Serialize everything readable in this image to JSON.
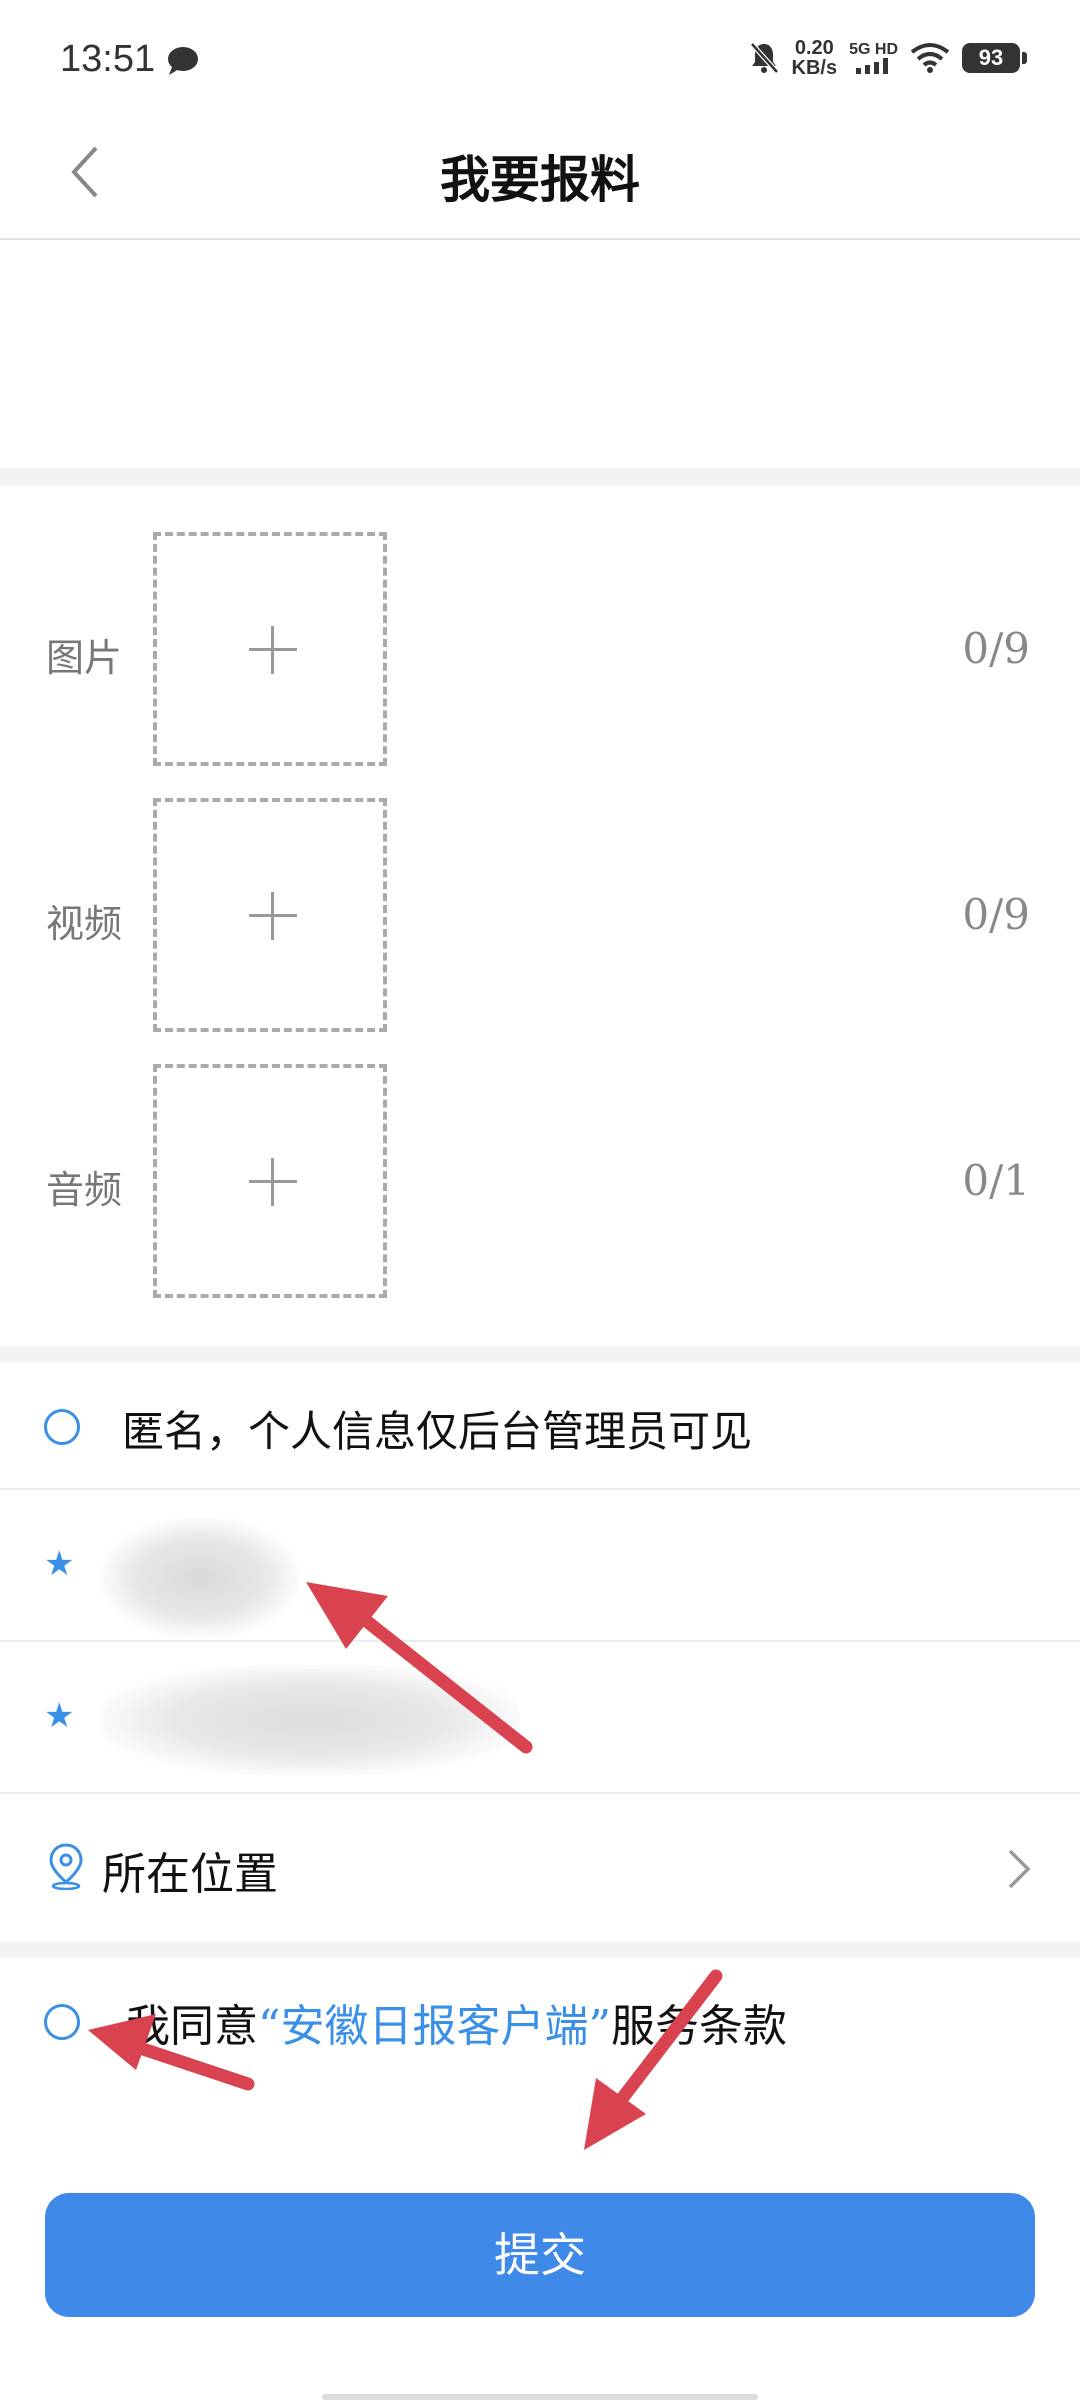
{
  "status_bar": {
    "time": "13:51",
    "speed_value": "0.20",
    "speed_unit": "KB/s",
    "network": "5G HD",
    "battery": "93"
  },
  "header": {
    "title": "我要报料"
  },
  "media": {
    "image": {
      "label": "图片",
      "count": "0/9"
    },
    "video": {
      "label": "视频",
      "count": "0/9"
    },
    "audio": {
      "label": "音频",
      "count": "0/1"
    }
  },
  "anonymous": {
    "label": "匿名，个人信息仅后台管理员可见"
  },
  "location": {
    "label": "所在位置"
  },
  "agreement": {
    "prefix": "我同意",
    "link": "“安徽日报客户端”",
    "suffix": "服务条款"
  },
  "submit": {
    "label": "提交"
  },
  "colors": {
    "accent": "#3a8fe6",
    "button": "#3f8ae8",
    "annotation_arrow": "#d9434f"
  }
}
